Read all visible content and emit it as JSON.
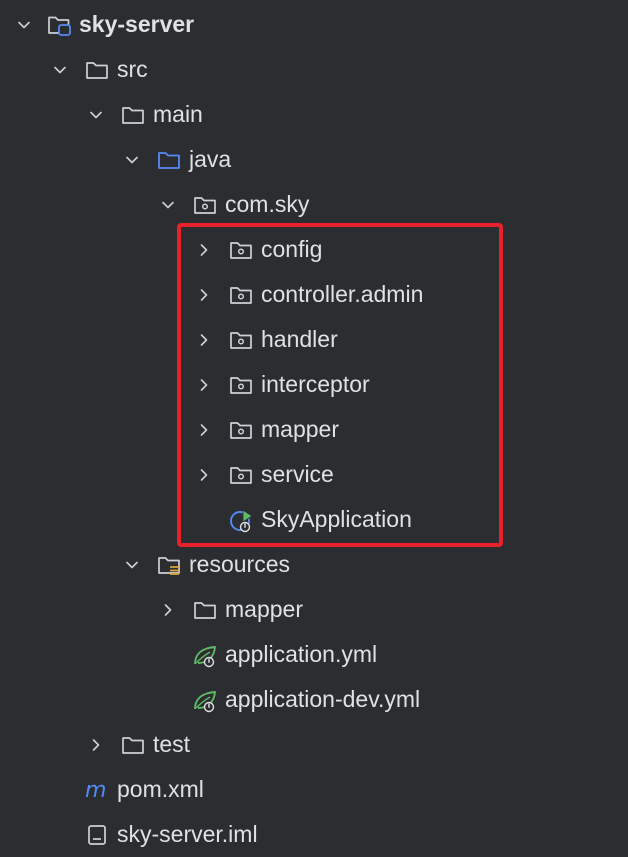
{
  "colors": {
    "background": "#2b2d30",
    "text": "#dfe1e5",
    "icon_gray": "#ced0d6",
    "java_blue": "#548af7",
    "module_blue": "#548af7",
    "spring_green": "#5fb865",
    "resources_yellow": "#d9a343",
    "maven_blue": "#548af7",
    "highlight_red": "#e8212a"
  },
  "tree": [
    {
      "label": "sky-server",
      "icon": "module-folder-icon",
      "expanded": true,
      "bold": true
    },
    {
      "label": "src",
      "icon": "folder-icon",
      "expanded": true
    },
    {
      "label": "main",
      "icon": "folder-icon",
      "expanded": true
    },
    {
      "label": "java",
      "icon": "source-root-folder-icon",
      "expanded": true
    },
    {
      "label": "com.sky",
      "icon": "package-icon",
      "expanded": true
    },
    {
      "label": "config",
      "icon": "package-icon",
      "expanded": false
    },
    {
      "label": "controller.admin",
      "icon": "package-icon",
      "expanded": false
    },
    {
      "label": "handler",
      "icon": "package-icon",
      "expanded": false
    },
    {
      "label": "interceptor",
      "icon": "package-icon",
      "expanded": false
    },
    {
      "label": "mapper",
      "icon": "package-icon",
      "expanded": false
    },
    {
      "label": "service",
      "icon": "package-icon",
      "expanded": false
    },
    {
      "label": "SkyApplication",
      "icon": "spring-boot-class-icon"
    },
    {
      "label": "resources",
      "icon": "resources-folder-icon",
      "expanded": true
    },
    {
      "label": "mapper",
      "icon": "folder-icon",
      "expanded": false
    },
    {
      "label": "application.yml",
      "icon": "spring-config-icon"
    },
    {
      "label": "application-dev.yml",
      "icon": "spring-config-icon"
    },
    {
      "label": "test",
      "icon": "folder-icon",
      "expanded": false
    },
    {
      "label": "pom.xml",
      "icon": "maven-icon"
    },
    {
      "label": "sky-server.iml",
      "icon": "iml-file-icon"
    }
  ]
}
